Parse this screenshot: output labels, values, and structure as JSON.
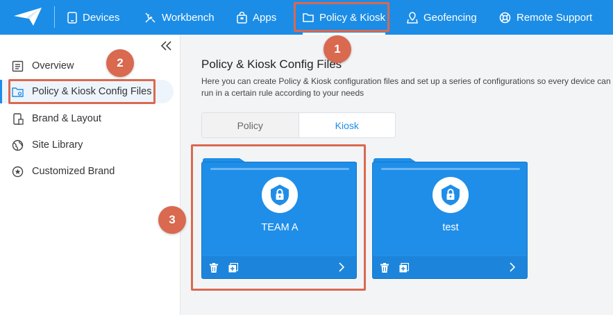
{
  "nav": {
    "items": [
      {
        "label": "Devices",
        "icon": "tablet-icon"
      },
      {
        "label": "Workbench",
        "icon": "tools-icon"
      },
      {
        "label": "Apps",
        "icon": "bag-icon"
      },
      {
        "label": "Policy & Kiosk",
        "icon": "folder-icon"
      },
      {
        "label": "Geofencing",
        "icon": "map-pin-icon"
      },
      {
        "label": "Remote Support",
        "icon": "lifebuoy-icon"
      }
    ],
    "active": "Policy & Kiosk"
  },
  "sidebar": {
    "items": [
      {
        "label": "Overview",
        "icon": "list-icon"
      },
      {
        "label": "Policy & Kiosk Config Files",
        "icon": "folder-settings-icon"
      },
      {
        "label": "Brand & Layout",
        "icon": "phone-layout-icon"
      },
      {
        "label": "Site Library",
        "icon": "globe-icon"
      },
      {
        "label": "Customized Brand",
        "icon": "star-circle-icon"
      }
    ],
    "active": "Policy & Kiosk Config Files"
  },
  "main": {
    "title": "Policy & Kiosk Config Files",
    "description": "Here you can create Policy & Kiosk configuration files and set up a series of configurations so every device can run in a certain rule according to your needs",
    "tabs": [
      "Policy",
      "Kiosk"
    ],
    "active_tab": "Kiosk",
    "cards": [
      {
        "name": "TEAM A"
      },
      {
        "name": "test"
      }
    ]
  },
  "annotations": [
    "1",
    "2",
    "3"
  ],
  "colors": {
    "brand": "#1c8de6",
    "card": "#1e8ee9",
    "annotation": "#d9694f"
  }
}
